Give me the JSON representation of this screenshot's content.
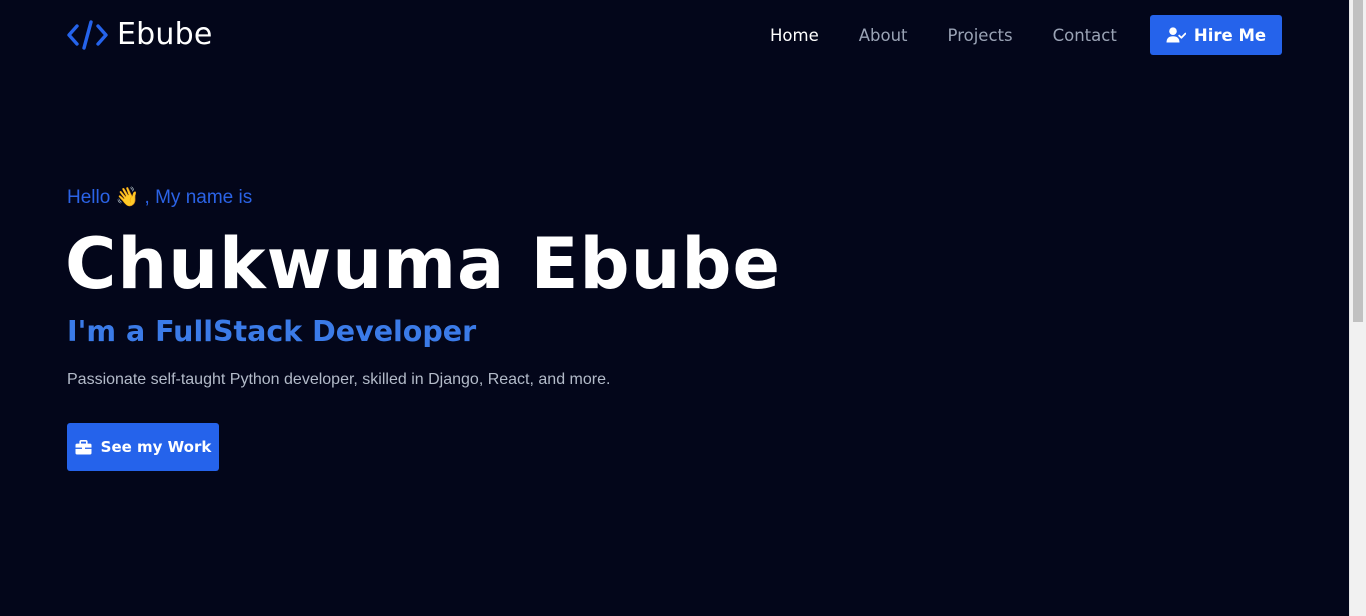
{
  "brand": {
    "name": "Ebube",
    "icon": "code-brackets-icon",
    "accent_color": "#2563eb"
  },
  "nav": {
    "items": [
      {
        "label": "Home",
        "active": true
      },
      {
        "label": "About",
        "active": false
      },
      {
        "label": "Projects",
        "active": false
      },
      {
        "label": "Contact",
        "active": false
      }
    ],
    "hire_button": {
      "label": "Hire Me",
      "icon": "user-check-icon"
    }
  },
  "hero": {
    "greeting_prefix": "Hello",
    "greeting_emoji": "👋",
    "greeting_suffix": ", My name is",
    "name": "Chukwuma Ebube",
    "role": "I'm a FullStack Developer",
    "description": "Passionate self-taught Python developer, skilled in Django, React, and more.",
    "cta": {
      "label": "See my Work",
      "icon": "briefcase-icon"
    }
  },
  "colors": {
    "background": "#03061a",
    "primary": "#2563eb",
    "greeting": "#2b63e6",
    "role": "#3b7be8",
    "muted_text": "#9aa3b5"
  }
}
